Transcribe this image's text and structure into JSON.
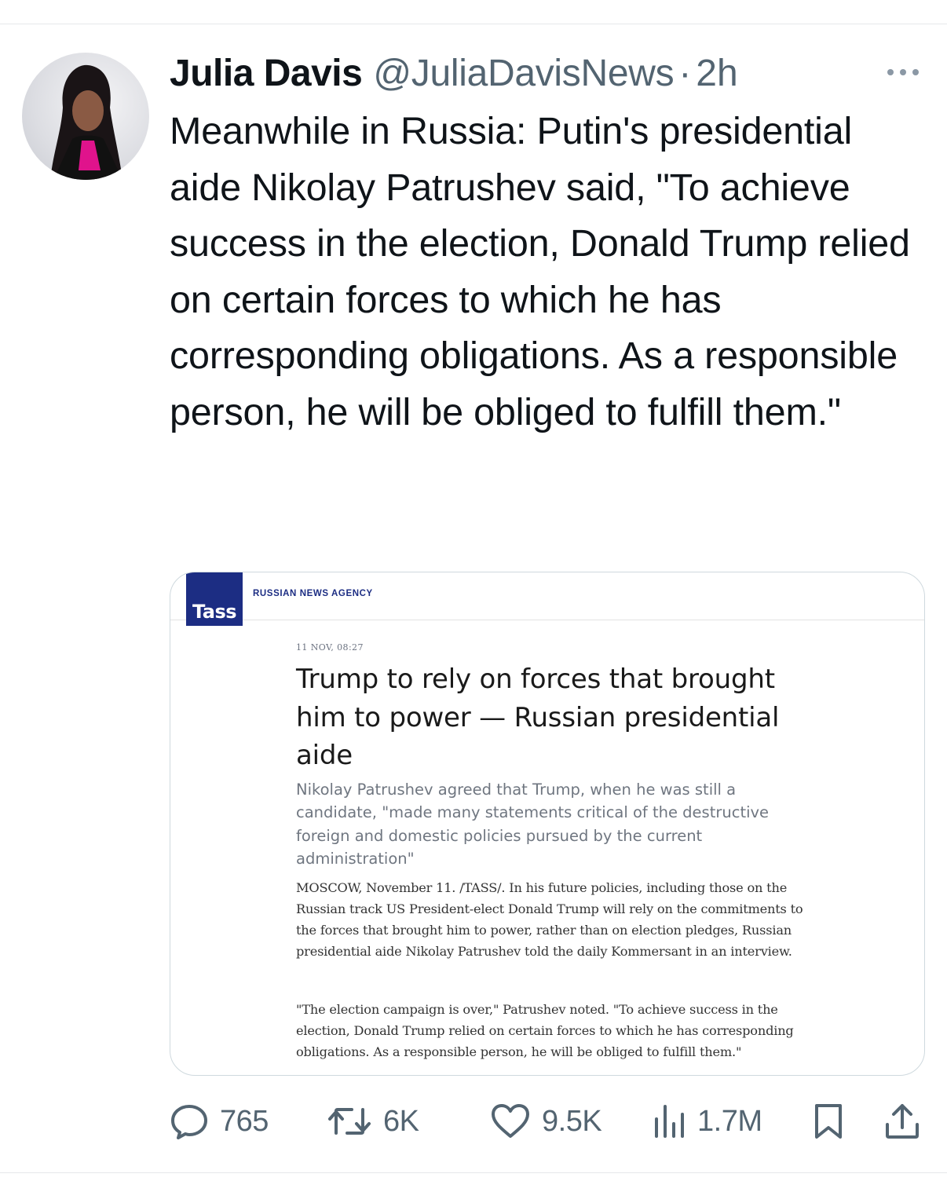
{
  "tweet": {
    "display_name": "Julia Davis",
    "handle": "@JuliaDavisNews",
    "separator": "·",
    "time": "2h",
    "text": "Meanwhile in Russia: Putin's presidential aide Nikolay Patrushev said, \"To achieve success in the election, Donald Trump relied on certain forces to which he has corresponding obligations. As a responsible person, he will be obliged to fulfill them.\""
  },
  "card": {
    "logo_text": "Tass",
    "agency": "RUSSIAN NEWS AGENCY",
    "meta": "11 NOV, 08:27",
    "headline": "Trump to rely on forces that brought him to power — Russian presidential aide",
    "lead": "Nikolay Patrushev agreed that Trump, when he was still a candidate, \"made many statements critical of the destructive foreign and domestic policies pursued by the current administration\"",
    "paragraph_1": "MOSCOW, November 11. /TASS/. In his future policies, including those on the Russian track US President-elect Donald Trump will rely on the commitments to the forces that brought him to power, rather than on election pledges, Russian presidential aide Nikolay Patrushev told the daily Kommersant in an interview.",
    "paragraph_2": "\"The election campaign is over,\" Patrushev noted. \"To achieve success in the election, Donald Trump relied on certain forces to which he has corresponding obligations. As a responsible person, he will be obliged to fulfill them.\""
  },
  "actions": {
    "replies": "765",
    "reposts": "6K",
    "likes": "9.5K",
    "views": "1.7M"
  },
  "colors": {
    "text": "#0f1419",
    "secondary": "#536471",
    "tass_blue": "#1c2d83",
    "border": "#cfd9de"
  },
  "icons": [
    "more-icon",
    "reply-icon",
    "repost-icon",
    "like-icon",
    "views-icon",
    "bookmark-icon",
    "share-icon"
  ]
}
